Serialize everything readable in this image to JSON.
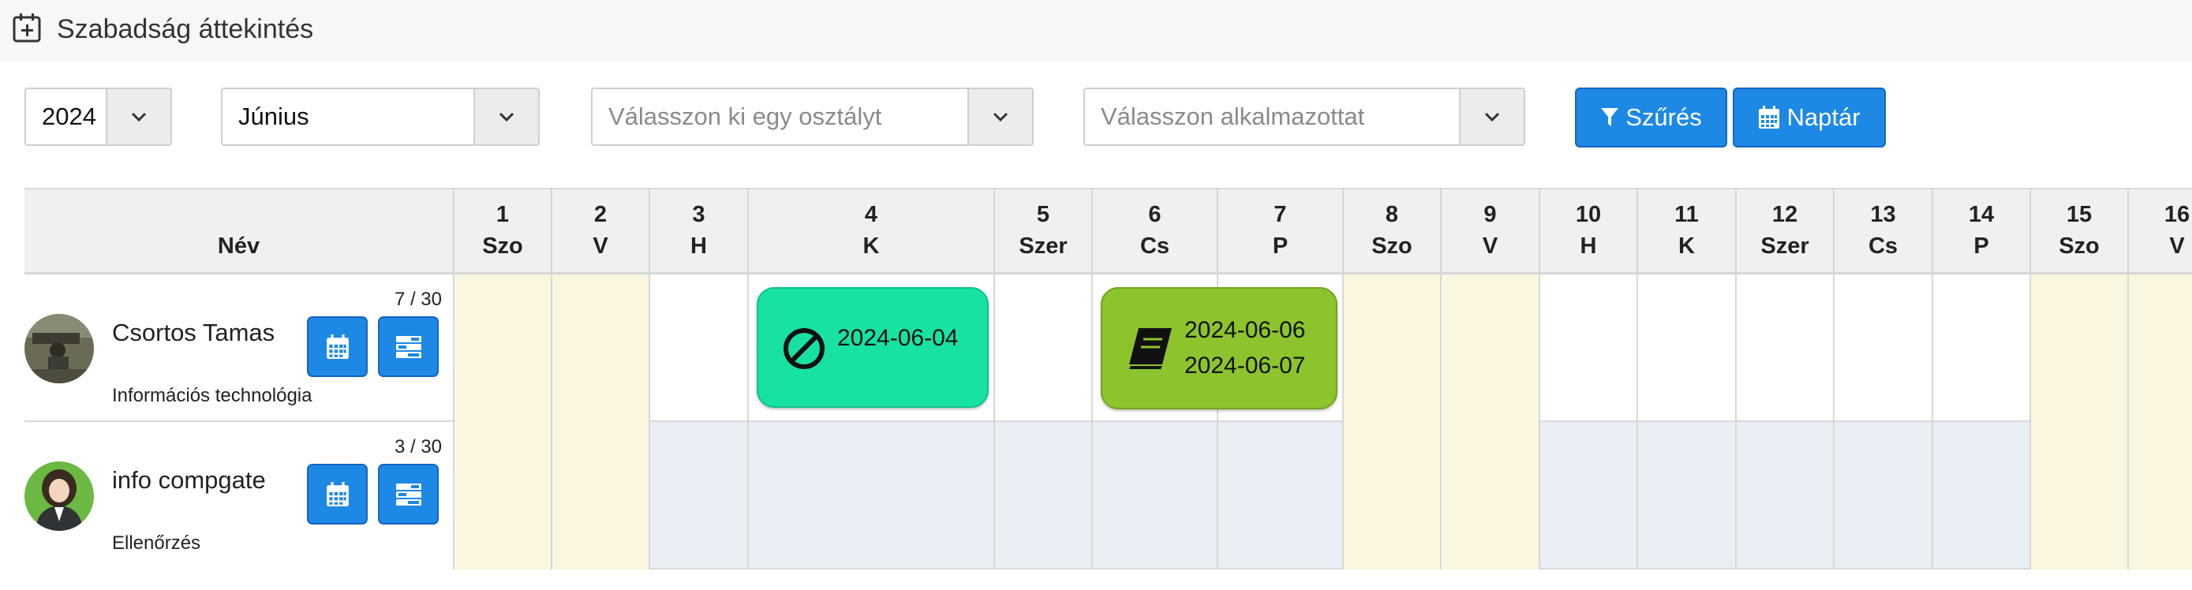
{
  "header": {
    "title": "Szabadság áttekintés",
    "icon": "calendar-plus-icon"
  },
  "filters": {
    "year": {
      "value": "2024"
    },
    "month": {
      "value": "Június"
    },
    "department": {
      "placeholder": "Válasszon ki egy osztályt"
    },
    "employee": {
      "placeholder": "Válasszon alkalmazottat"
    },
    "filter_button": {
      "label": "Szűrés",
      "icon": "filter-icon"
    },
    "calendar_button": {
      "label": "Naptár",
      "icon": "calendar-icon"
    }
  },
  "colors": {
    "accent": "#1e88e5",
    "weekend": "#fbf6e0",
    "alt_row": "#e9eff5",
    "event_holiday": "#17e1a3",
    "event_study": "#8dc42d"
  },
  "table": {
    "name_header": "Név",
    "days": [
      {
        "num": "1",
        "label": "Szo"
      },
      {
        "num": "2",
        "label": "V"
      },
      {
        "num": "3",
        "label": "H"
      },
      {
        "num": "4",
        "label": "K"
      },
      {
        "num": "5",
        "label": "Szer"
      },
      {
        "num": "6",
        "label": "Cs"
      },
      {
        "num": "7",
        "label": "P"
      },
      {
        "num": "8",
        "label": "Szo"
      },
      {
        "num": "9",
        "label": "V"
      },
      {
        "num": "10",
        "label": "H"
      },
      {
        "num": "11",
        "label": "K"
      },
      {
        "num": "12",
        "label": "Szer"
      },
      {
        "num": "13",
        "label": "Cs"
      },
      {
        "num": "14",
        "label": "P"
      },
      {
        "num": "15",
        "label": "Szo"
      },
      {
        "num": "16",
        "label": "V"
      }
    ],
    "rows": [
      {
        "name": "Csortos Tamas",
        "department": "Információs technológia",
        "count": "7 / 30",
        "avatar": "user-photo-icon",
        "events": [
          {
            "icon": "ban-icon",
            "dates": [
              "2024-06-04"
            ]
          },
          {
            "icon": "book-icon",
            "dates": [
              "2024-06-06",
              "2024-06-07"
            ]
          }
        ]
      },
      {
        "name": "info compgate",
        "department": "Ellenőrzés",
        "count": "3 / 30",
        "avatar": "user-avatar-icon",
        "events": []
      }
    ]
  }
}
